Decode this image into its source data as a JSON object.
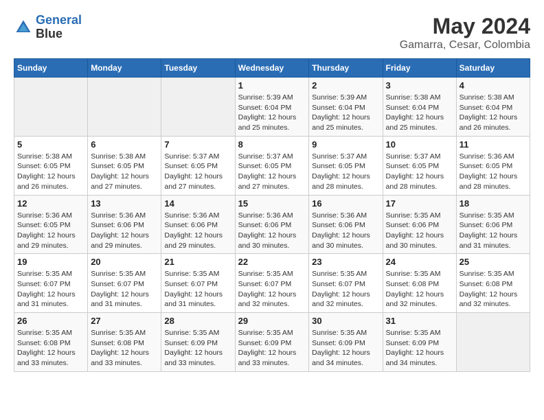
{
  "header": {
    "logo_line1": "General",
    "logo_line2": "Blue",
    "month_year": "May 2024",
    "location": "Gamarra, Cesar, Colombia"
  },
  "weekdays": [
    "Sunday",
    "Monday",
    "Tuesday",
    "Wednesday",
    "Thursday",
    "Friday",
    "Saturday"
  ],
  "weeks": [
    [
      {
        "day": "",
        "info": ""
      },
      {
        "day": "",
        "info": ""
      },
      {
        "day": "",
        "info": ""
      },
      {
        "day": "1",
        "info": "Sunrise: 5:39 AM\nSunset: 6:04 PM\nDaylight: 12 hours\nand 25 minutes."
      },
      {
        "day": "2",
        "info": "Sunrise: 5:39 AM\nSunset: 6:04 PM\nDaylight: 12 hours\nand 25 minutes."
      },
      {
        "day": "3",
        "info": "Sunrise: 5:38 AM\nSunset: 6:04 PM\nDaylight: 12 hours\nand 25 minutes."
      },
      {
        "day": "4",
        "info": "Sunrise: 5:38 AM\nSunset: 6:04 PM\nDaylight: 12 hours\nand 26 minutes."
      }
    ],
    [
      {
        "day": "5",
        "info": "Sunrise: 5:38 AM\nSunset: 6:05 PM\nDaylight: 12 hours\nand 26 minutes."
      },
      {
        "day": "6",
        "info": "Sunrise: 5:38 AM\nSunset: 6:05 PM\nDaylight: 12 hours\nand 27 minutes."
      },
      {
        "day": "7",
        "info": "Sunrise: 5:37 AM\nSunset: 6:05 PM\nDaylight: 12 hours\nand 27 minutes."
      },
      {
        "day": "8",
        "info": "Sunrise: 5:37 AM\nSunset: 6:05 PM\nDaylight: 12 hours\nand 27 minutes."
      },
      {
        "day": "9",
        "info": "Sunrise: 5:37 AM\nSunset: 6:05 PM\nDaylight: 12 hours\nand 28 minutes."
      },
      {
        "day": "10",
        "info": "Sunrise: 5:37 AM\nSunset: 6:05 PM\nDaylight: 12 hours\nand 28 minutes."
      },
      {
        "day": "11",
        "info": "Sunrise: 5:36 AM\nSunset: 6:05 PM\nDaylight: 12 hours\nand 28 minutes."
      }
    ],
    [
      {
        "day": "12",
        "info": "Sunrise: 5:36 AM\nSunset: 6:05 PM\nDaylight: 12 hours\nand 29 minutes."
      },
      {
        "day": "13",
        "info": "Sunrise: 5:36 AM\nSunset: 6:06 PM\nDaylight: 12 hours\nand 29 minutes."
      },
      {
        "day": "14",
        "info": "Sunrise: 5:36 AM\nSunset: 6:06 PM\nDaylight: 12 hours\nand 29 minutes."
      },
      {
        "day": "15",
        "info": "Sunrise: 5:36 AM\nSunset: 6:06 PM\nDaylight: 12 hours\nand 30 minutes."
      },
      {
        "day": "16",
        "info": "Sunrise: 5:36 AM\nSunset: 6:06 PM\nDaylight: 12 hours\nand 30 minutes."
      },
      {
        "day": "17",
        "info": "Sunrise: 5:35 AM\nSunset: 6:06 PM\nDaylight: 12 hours\nand 30 minutes."
      },
      {
        "day": "18",
        "info": "Sunrise: 5:35 AM\nSunset: 6:06 PM\nDaylight: 12 hours\nand 31 minutes."
      }
    ],
    [
      {
        "day": "19",
        "info": "Sunrise: 5:35 AM\nSunset: 6:07 PM\nDaylight: 12 hours\nand 31 minutes."
      },
      {
        "day": "20",
        "info": "Sunrise: 5:35 AM\nSunset: 6:07 PM\nDaylight: 12 hours\nand 31 minutes."
      },
      {
        "day": "21",
        "info": "Sunrise: 5:35 AM\nSunset: 6:07 PM\nDaylight: 12 hours\nand 31 minutes."
      },
      {
        "day": "22",
        "info": "Sunrise: 5:35 AM\nSunset: 6:07 PM\nDaylight: 12 hours\nand 32 minutes."
      },
      {
        "day": "23",
        "info": "Sunrise: 5:35 AM\nSunset: 6:07 PM\nDaylight: 12 hours\nand 32 minutes."
      },
      {
        "day": "24",
        "info": "Sunrise: 5:35 AM\nSunset: 6:08 PM\nDaylight: 12 hours\nand 32 minutes."
      },
      {
        "day": "25",
        "info": "Sunrise: 5:35 AM\nSunset: 6:08 PM\nDaylight: 12 hours\nand 32 minutes."
      }
    ],
    [
      {
        "day": "26",
        "info": "Sunrise: 5:35 AM\nSunset: 6:08 PM\nDaylight: 12 hours\nand 33 minutes."
      },
      {
        "day": "27",
        "info": "Sunrise: 5:35 AM\nSunset: 6:08 PM\nDaylight: 12 hours\nand 33 minutes."
      },
      {
        "day": "28",
        "info": "Sunrise: 5:35 AM\nSunset: 6:09 PM\nDaylight: 12 hours\nand 33 minutes."
      },
      {
        "day": "29",
        "info": "Sunrise: 5:35 AM\nSunset: 6:09 PM\nDaylight: 12 hours\nand 33 minutes."
      },
      {
        "day": "30",
        "info": "Sunrise: 5:35 AM\nSunset: 6:09 PM\nDaylight: 12 hours\nand 34 minutes."
      },
      {
        "day": "31",
        "info": "Sunrise: 5:35 AM\nSunset: 6:09 PM\nDaylight: 12 hours\nand 34 minutes."
      },
      {
        "day": "",
        "info": ""
      }
    ]
  ]
}
